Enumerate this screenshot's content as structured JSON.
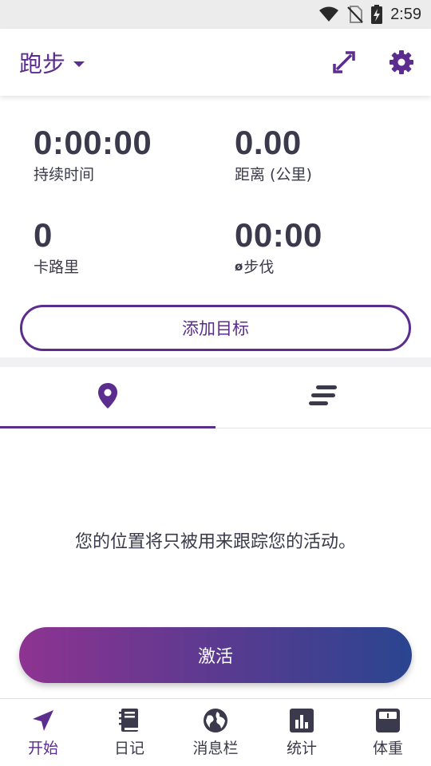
{
  "status_bar": {
    "time": "2:59",
    "icons": [
      "wifi-icon",
      "no-sim-icon",
      "battery-charging-icon"
    ]
  },
  "header": {
    "activity": "跑步",
    "icons": [
      "swap-arrows-icon",
      "gear-icon"
    ]
  },
  "stats": [
    {
      "value": "0:00:00",
      "label": "持续时间"
    },
    {
      "value": "0.00",
      "label": "距离 (公里)"
    },
    {
      "value": "0",
      "label": "卡路里"
    },
    {
      "value": "00:00",
      "label": "步伐",
      "label_prefix": "ø"
    }
  ],
  "goal_button": {
    "label": "添加目标"
  },
  "tabs": [
    {
      "icon": "location-pin-icon",
      "active": true
    },
    {
      "icon": "list-lines-icon",
      "active": false
    }
  ],
  "content": {
    "location_note": "您的位置将只被用来跟踪您的活动。",
    "activate_button": "激活"
  },
  "bottom_nav": [
    {
      "label": "开始",
      "icon": "navigation-arrow-icon",
      "active": true
    },
    {
      "label": "日记",
      "icon": "diary-book-icon",
      "active": false
    },
    {
      "label": "消息栏",
      "icon": "globe-icon",
      "active": false
    },
    {
      "label": "统计",
      "icon": "bar-chart-icon",
      "active": false
    },
    {
      "label": "体重",
      "icon": "scale-icon",
      "active": false
    }
  ],
  "colors": {
    "accent": "#5b2d8e",
    "gradient_start": "#8e3391",
    "gradient_end": "#2a4590",
    "text": "#3a3a4a"
  }
}
